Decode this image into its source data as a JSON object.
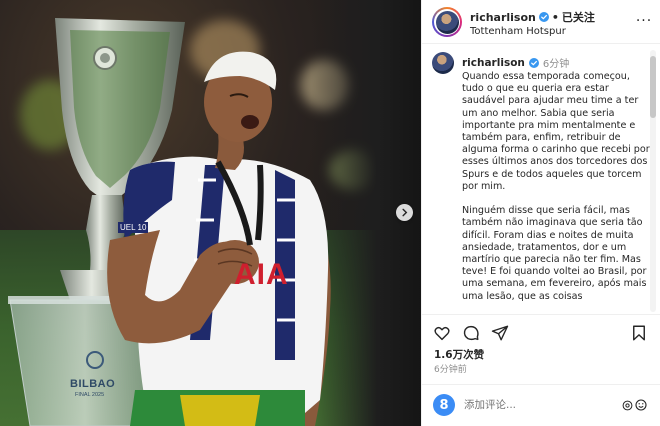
{
  "post": {
    "username": "richarlison",
    "follow_status": "已关注",
    "separator": "•",
    "location": "Tottenham Hotspur",
    "more_label": "···",
    "time_posted": "6分钟",
    "caption_paragraphs": [
      "Quando essa temporada começou, tudo o que eu queria era estar saudável para ajudar meu time a ter um ano melhor. Sabia que seria importante pra mim mentalmente e também para, enfim, retribuir de alguma forma o carinho que recebi por esses últimos anos dos torcedores dos Spurs e de todos aqueles que torcem por mim.",
      "Ninguém disse que seria fácil, mas também não imaginava que seria tão difícil. Foram dias e noites de muita ansiedade, tratamentos, dor e um martírio que parecia não ter fim. Mas teve! E foi quando voltei ao Brasil, por uma semana, em fevereiro, após mais uma lesão, que as coisas"
    ],
    "likes": "1.6万次赞",
    "time_ago": "6分钟前",
    "comment_placeholder": "添加评论...",
    "comment_logo_glyph": "8"
  },
  "photo": {
    "shirt_sponsor": "AIA",
    "trophy_text": "BILBAO",
    "trophy_subtext": "FINAL 2025",
    "sleeve_text": "UEL 10"
  },
  "icons": {
    "verified": "verified-icon",
    "heart": "heart-icon",
    "comment": "comment-icon",
    "share": "share-icon",
    "save": "bookmark-icon",
    "emoji": "emoji-icon",
    "next": "chevron-right-icon"
  },
  "colors": {
    "verified_blue": "#3897f0",
    "muted_text": "#8e8e8e",
    "comment_logo": "#3b8cf5",
    "jersey_white": "#f4f4f4",
    "scarf_navy": "#1f2a6b",
    "shorts_green": "#2d8a3a"
  }
}
